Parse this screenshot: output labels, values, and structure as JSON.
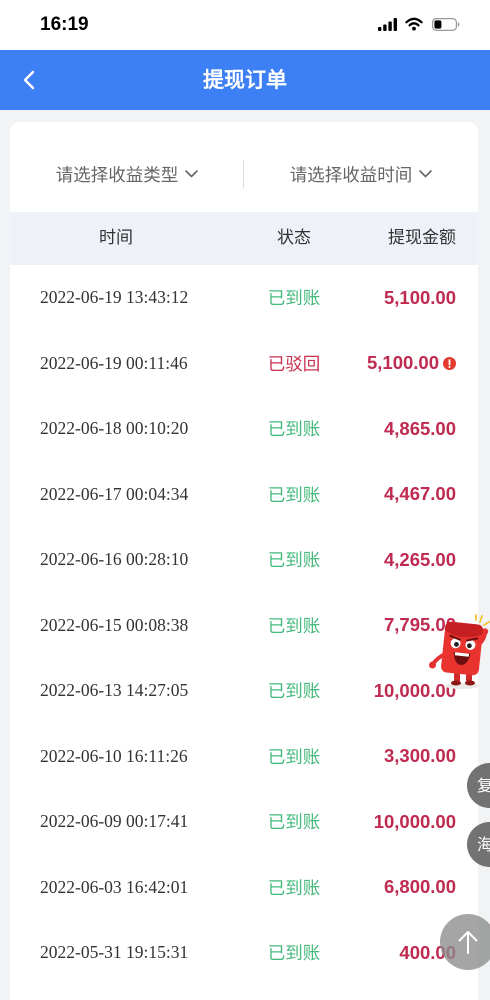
{
  "status_bar": {
    "time": "16:19",
    "icons": [
      "signal-icon",
      "wifi-icon",
      "battery-icon"
    ]
  },
  "header": {
    "title": "提现订单",
    "back_icon": "chevron-left-icon"
  },
  "filters": [
    {
      "label": "请选择收益类型",
      "icon": "chevron-down-icon"
    },
    {
      "label": "请选择收益时间",
      "icon": "chevron-down-icon"
    }
  ],
  "table": {
    "columns": [
      "时间",
      "状态",
      "提现金额"
    ],
    "rows": [
      {
        "time": "2022-06-19 13:43:12",
        "status": "已到账",
        "amount": "5,100.00"
      },
      {
        "time": "2022-06-19 00:11:46",
        "status": "已驳回",
        "amount": "5,100.00",
        "icon": "exclamation-circle-icon"
      },
      {
        "time": "2022-06-18 00:10:20",
        "status": "已到账",
        "amount": "4,865.00"
      },
      {
        "time": "2022-06-17 00:04:34",
        "status": "已到账",
        "amount": "4,467.00"
      },
      {
        "time": "2022-06-16 00:28:10",
        "status": "已到账",
        "amount": "4,265.00"
      },
      {
        "time": "2022-06-15 00:08:38",
        "status": "已到账",
        "amount": "7,795.00"
      },
      {
        "time": "2022-06-13 14:27:05",
        "status": "已到账",
        "amount": "10,000.00"
      },
      {
        "time": "2022-06-10 16:11:26",
        "status": "已到账",
        "amount": "3,300.00"
      },
      {
        "time": "2022-06-09 00:17:41",
        "status": "已到账",
        "amount": "10,000.00"
      },
      {
        "time": "2022-06-03 16:42:01",
        "status": "已到账",
        "amount": "6,800.00"
      },
      {
        "time": "2022-05-31 19:15:31",
        "status": "已到账",
        "amount": "400.00"
      }
    ]
  },
  "floating": {
    "mascot_icon": "red-envelope-mascot-icon",
    "side_buttons": [
      {
        "label": "复"
      },
      {
        "label": "海"
      }
    ],
    "scroll_top_icon": "arrow-up-icon"
  },
  "colors": {
    "header_bg": "#3d7ff5",
    "page_bg": "#f2f3f5",
    "table_header_bg": "#eef1f8",
    "amount": "#bf2a50",
    "alert": "#e23a2e",
    "status": {
      "已到账": "#45b97c",
      "已驳回": "#c8314f"
    }
  }
}
